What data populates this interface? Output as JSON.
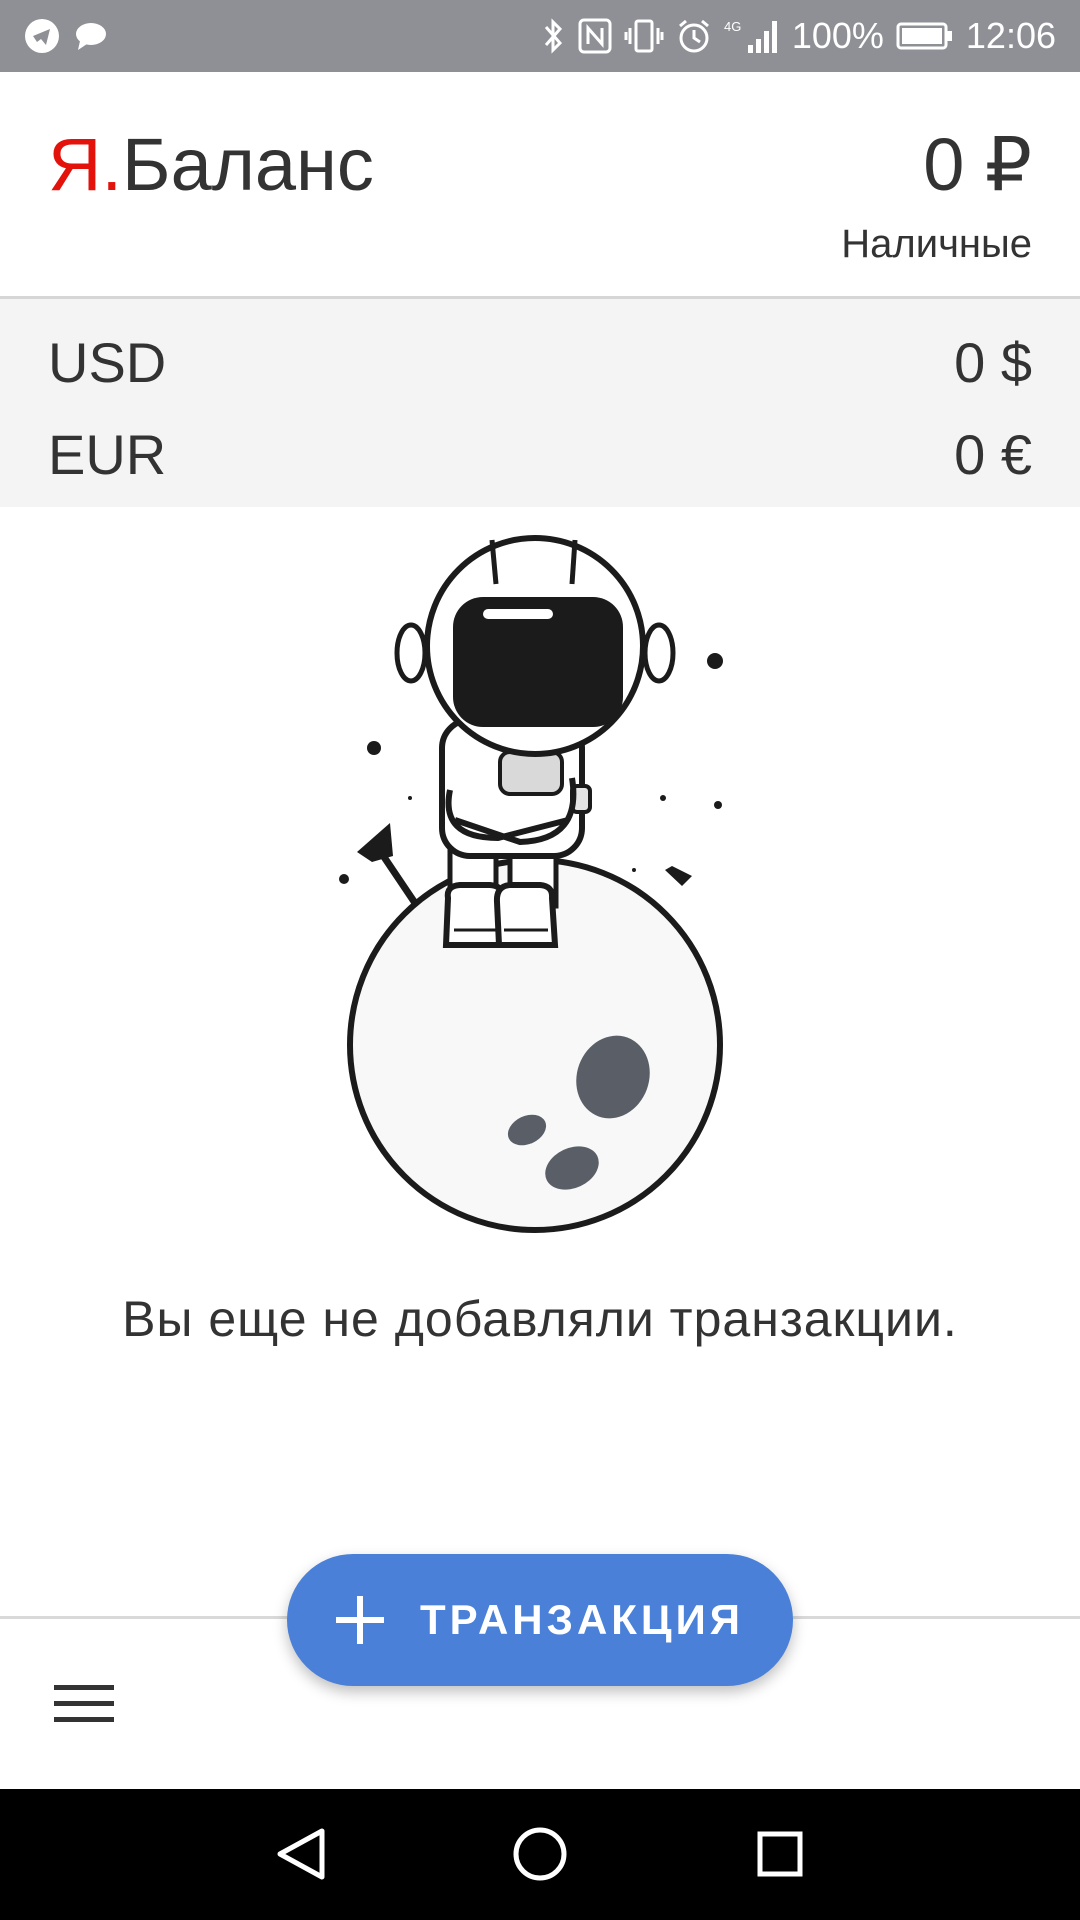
{
  "status_bar": {
    "battery": "100%",
    "time": "12:06",
    "network": "4G",
    "left_icons": [
      "telegram-icon",
      "message-icon"
    ],
    "right_icons": [
      "bluetooth-icon",
      "nfc-icon",
      "vibrate-icon",
      "alarm-icon",
      "signal-icon",
      "battery-icon"
    ]
  },
  "header": {
    "logo_prefix": "Я.",
    "logo_text": "Баланс",
    "balance": "0 ₽",
    "account": "Наличные"
  },
  "currencies": [
    {
      "code": "USD",
      "value": "0 $"
    },
    {
      "code": "EUR",
      "value": "0 €"
    }
  ],
  "empty_state": {
    "message": "Вы еще не добавляли транзакции."
  },
  "fab": {
    "label": "ТРАНЗАКЦИЯ",
    "icon": "plus-icon"
  },
  "bottom_bar": {
    "menu_icon": "menu-icon"
  },
  "nav_bar": {
    "buttons": [
      "back-icon",
      "home-icon",
      "recents-icon"
    ]
  },
  "colors": {
    "accent": "#4a80d8",
    "brand_red": "#e3120b",
    "status_bar": "#8f9095",
    "currency_bg": "#f4f4f4"
  }
}
